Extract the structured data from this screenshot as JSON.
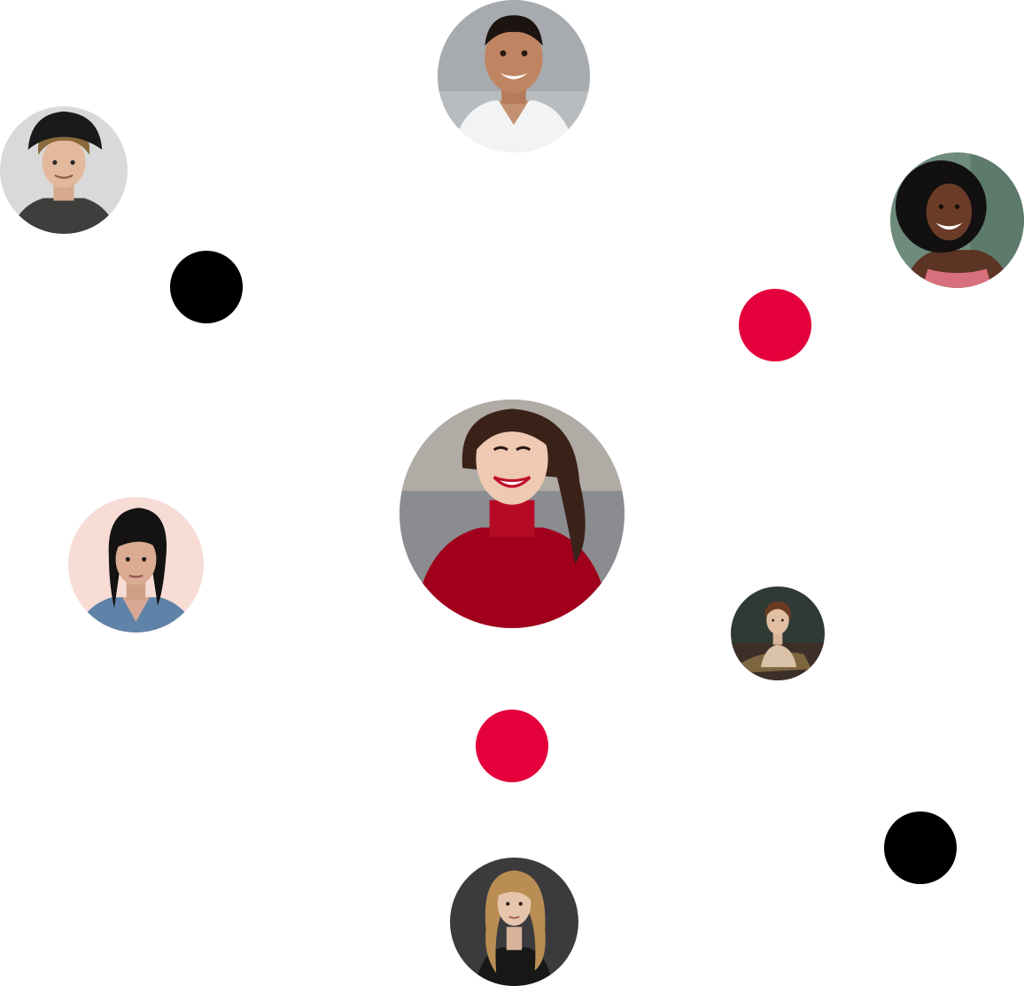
{
  "colors": {
    "background": "#ffffff",
    "accent": "#e4003a",
    "dark": "#000000"
  },
  "avatars": [
    {
      "name": "man-white-tee",
      "icon": "user-avatar-icon"
    },
    {
      "name": "young-man-hat",
      "icon": "user-avatar-icon"
    },
    {
      "name": "woman-curly-hair",
      "icon": "user-avatar-icon"
    },
    {
      "name": "woman-red-sweater",
      "icon": "user-avatar-icon"
    },
    {
      "name": "woman-denim-jacket",
      "icon": "user-avatar-icon"
    },
    {
      "name": "woman-portrait-painting",
      "icon": "user-avatar-icon"
    },
    {
      "name": "woman-blonde",
      "icon": "user-avatar-icon"
    }
  ],
  "dots": [
    {
      "color": "#000000"
    },
    {
      "color": "#e4003a"
    },
    {
      "color": "#e4003a"
    },
    {
      "color": "#000000"
    }
  ]
}
